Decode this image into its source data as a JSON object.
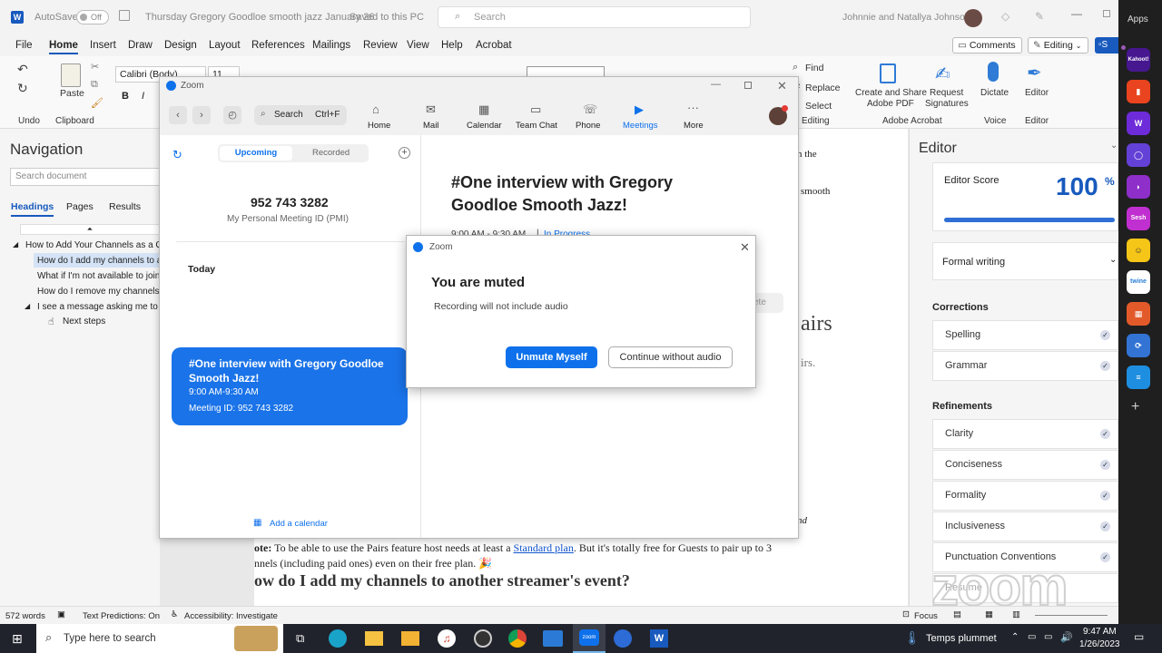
{
  "word": {
    "autosave_label": "AutoSave",
    "autosave_state": "Off",
    "doc_title": "Thursday Gregory Goodloe smooth jazz January 26",
    "save_status": "Saved to this PC",
    "search_placeholder": "Search",
    "user_name": "Johnnie and Natallya Johnson",
    "menus": [
      "File",
      "Home",
      "Insert",
      "Draw",
      "Design",
      "Layout",
      "References",
      "Mailings",
      "Review",
      "View",
      "Help",
      "Acrobat"
    ],
    "comments_label": "Comments",
    "editing_label": "Editing",
    "ribbon": {
      "undo": "Undo",
      "paste": "Paste",
      "clipboard": "Clipboard",
      "font_name": "Calibri (Body)",
      "font_size": "11",
      "find": "Find",
      "replace": "Replace",
      "select": "Select",
      "editing_group": "Editing",
      "create_share": "Create and Share",
      "adobe_pdf": "Adobe PDF",
      "request": "Request",
      "signatures": "Signatures",
      "adobe_acrobat": "Adobe Acrobat",
      "dictate": "Dictate",
      "voice": "Voice",
      "editor": "Editor",
      "editor_group": "Editor"
    },
    "nav": {
      "title": "Navigation",
      "search_placeholder": "Search document",
      "tabs": [
        "Headings",
        "Pages",
        "Results"
      ],
      "headings": [
        "How to Add Your Channels as a Gu",
        "How do I add my channels to ar",
        "What if I'm not available to join",
        "How do I remove my channels f",
        "I see a message asking me to co",
        "Next steps"
      ]
    },
    "doc": {
      "frag1": "n the",
      "frag2": "smooth",
      "frag3": "airs",
      "frag4": "irs.",
      "frag5": "nd",
      "note_prefix": "ote:",
      "note_text": " To be able to use the Pairs feature host needs at least a ",
      "note_link": "Standard plan",
      "note_rest": ". But it's totally free for Guests to pair up to 3",
      "note_line2": "nnels (including paid ones) even on their free plan. 🎉",
      "heading": "ow do I add my channels to another streamer's event?"
    },
    "editor_pane": {
      "title": "Editor",
      "score_label": "Editor Score",
      "score": "100",
      "score_unit": "%",
      "score_fraction": 1.0,
      "writing_style": "Formal writing",
      "corrections_title": "Corrections",
      "corrections": [
        "Spelling",
        "Grammar"
      ],
      "refinements_title": "Refinements",
      "refinements": [
        "Clarity",
        "Conciseness",
        "Formality",
        "Inclusiveness",
        "Punctuation Conventions",
        "Resume"
      ]
    },
    "status": {
      "words": "572 words",
      "predictions": "Text Predictions: On",
      "accessibility": "Accessibility: Investigate",
      "focus": "Focus"
    }
  },
  "zoom": {
    "title": "Zoom",
    "search_label": "Search",
    "search_shortcut": "Ctrl+F",
    "nav": [
      "Home",
      "Mail",
      "Calendar",
      "Team Chat",
      "Phone",
      "Meetings",
      "More"
    ],
    "tabs": [
      "Upcoming",
      "Recorded"
    ],
    "pmi_number": "952 743 3282",
    "pmi_label": "My Personal Meeting ID (PMI)",
    "today_label": "Today",
    "meeting": {
      "title": "#One interview with Gregory Goodloe Smooth Jazz!",
      "time": "9:00 AM-9:30 AM",
      "meeting_id": "Meeting ID: 952 743 3282"
    },
    "add_calendar": "Add a calendar",
    "detail": {
      "title": "#One interview with Gregory Goodloe Smooth Jazz!",
      "time": "9:00 AM - 9:30 AM",
      "status": "In Progress",
      "delete_frag": "ete"
    }
  },
  "dialog": {
    "title": "Zoom",
    "heading": "You are muted",
    "message": "Recording will not include audio",
    "primary_button": "Unmute Myself",
    "secondary_button": "Continue without audio"
  },
  "teams": {
    "apps_label": "Apps",
    "app_icons": [
      "Kahoot!",
      "Sesh",
      "twine"
    ]
  },
  "watermark": "zoom",
  "taskbar": {
    "search_placeholder": "Type here to search",
    "weather": "Temps plummet",
    "time": "9:47 AM",
    "date": "1/26/2023"
  },
  "colors": {
    "zoom_blue": "#0e71eb",
    "word_blue": "#185abd",
    "meeting_card": "#1a73e8"
  }
}
